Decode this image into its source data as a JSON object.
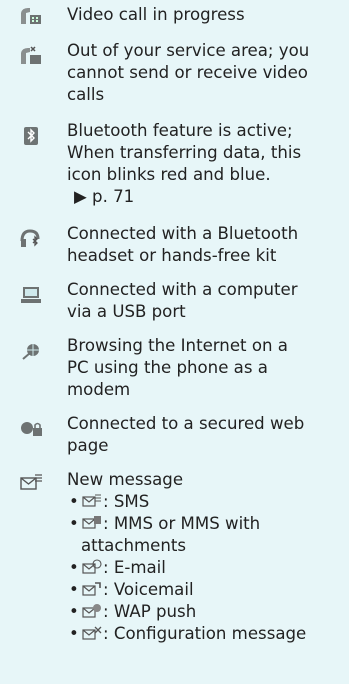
{
  "colors": {
    "background": "#e7f6f8",
    "text": "#222222"
  },
  "entries": [
    {
      "icon": "video-call-icon",
      "lines": [
        "Video call in progress"
      ]
    },
    {
      "icon": "video-call-no-service-icon",
      "lines": [
        "Out of your service area; you",
        "cannot send or receive video",
        "calls"
      ]
    },
    {
      "icon": "bluetooth-icon",
      "lines": [
        "Bluetooth feature is active;",
        "When transferring data, this",
        "icon blinks red and blue."
      ],
      "ref": "▶ p. 71"
    },
    {
      "icon": "bluetooth-headset-icon",
      "lines": [
        "Connected with a Bluetooth",
        "headset or hands-free kit"
      ]
    },
    {
      "icon": "computer-icon",
      "lines": [
        "Connected with a computer",
        "via a USB port"
      ]
    },
    {
      "icon": "internet-browsing-icon",
      "lines": [
        "Browsing the Internet on a",
        "PC using the phone as a",
        "modem"
      ]
    },
    {
      "icon": "secured-web-icon",
      "lines": [
        "Connected to a secured web",
        "page"
      ]
    },
    {
      "icon": "new-message-icon",
      "lines": [
        "New message"
      ]
    }
  ],
  "message_types": [
    {
      "icon": "sms-icon",
      "text": ": SMS"
    },
    {
      "icon": "mms-icon",
      "text": ": MMS or MMS with",
      "cont": "attachments"
    },
    {
      "icon": "email-icon",
      "text": ": E-mail"
    },
    {
      "icon": "voicemail-icon",
      "text": ": Voicemail"
    },
    {
      "icon": "wap-push-icon",
      "text": ": WAP push"
    },
    {
      "icon": "configuration-message-icon",
      "text": ": Configuration message"
    }
  ]
}
